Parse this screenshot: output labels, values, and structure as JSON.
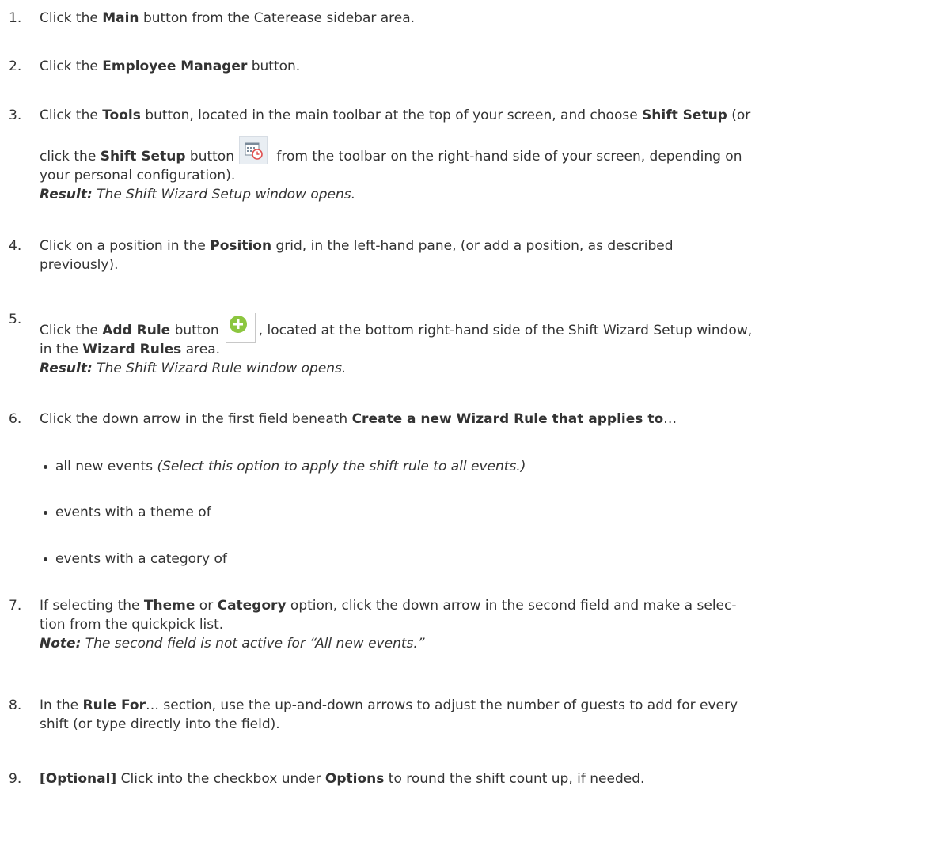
{
  "steps": [
    {
      "num": "1.",
      "pre": "Click the ",
      "b1": "Main",
      "post": " button from the Caterease sidebar area."
    },
    {
      "num": "2.",
      "pre": "Click the ",
      "b1": "Employee Manager",
      "post": " button."
    },
    {
      "num": "3.",
      "l1_pre": "Click the ",
      "l1_b1": "Tools",
      "l1_mid": " button, located in the main toolbar at the top of your screen, and choose ",
      "l1_b2": "Shift Setup",
      "l1_post": " (or",
      "l2_pre": "click the ",
      "l2_b1": "Shift Setup",
      "l2_mid": " button",
      "l2_post": " from the toolbar on the right-hand side of your screen, depending on",
      "l3": "your personal configuration).",
      "result_label": "Result:",
      "result_text": " The Shift Wizard Setup window opens."
    },
    {
      "num": "4.",
      "l1_pre": "Click on a position in the ",
      "l1_b1": "Position",
      "l1_post": " grid, in the left-hand pane, (or add a position, as described",
      "l2": "previously)."
    },
    {
      "num": "5.",
      "l1_pre": "Click the ",
      "l1_b1": "Add Rule",
      "l1_mid": " button",
      "l1_post": ", located at the bottom right-hand side of the Shift Wizard Setup window,",
      "l2_pre": "in the ",
      "l2_b1": "Wizard Rules",
      "l2_post": " area.",
      "result_label": "Result:",
      "result_text": " The Shift Wizard Rule window opens."
    },
    {
      "num": "6.",
      "pre": "Click the down arrow in the first field beneath ",
      "b1": "Create a new Wizard Rule that applies to",
      "post": "…"
    },
    {
      "num": "7.",
      "l1_pre": "If selecting the ",
      "l1_b1": "Theme",
      "l1_mid": " or ",
      "l1_b2": "Category",
      "l1_post": " option, click the down arrow in the second field and make a selec-",
      "l2": "tion from the quickpick list.",
      "note_label": "Note:",
      "note_text": " The second field is not active for “All new events.”"
    },
    {
      "num": "8.",
      "l1_pre": "In the ",
      "l1_b1": "Rule For",
      "l1_post": "… section, use the up-and-down arrows to adjust the number of guests to add for every",
      "l2": "shift (or type directly into the field)."
    },
    {
      "num": "9.",
      "b0": "[Optional]",
      "pre": " Click into the checkbox under ",
      "b1": "Options",
      "post": " to round the shift count up, if needed."
    }
  ],
  "bullets": [
    {
      "text": "all new events ",
      "italic": "(Select this option to apply the shift rule to all events.)"
    },
    {
      "text": "events with a theme of",
      "italic": ""
    },
    {
      "text": "events with a category of",
      "italic": ""
    }
  ],
  "icons": {
    "shift_setup": "calendar-clock-icon",
    "add_rule": "green-plus-circle-icon"
  },
  "colors": {
    "text": "#333333",
    "add_icon": "#8cc63f"
  }
}
